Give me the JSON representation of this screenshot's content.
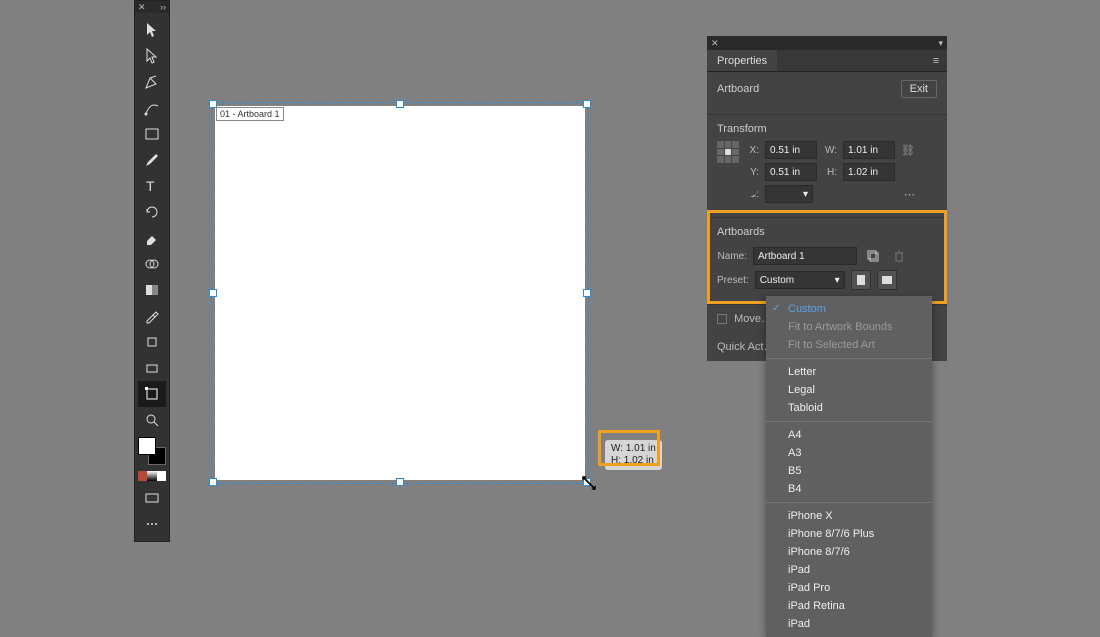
{
  "toolbar": {
    "close_glyph": "✕",
    "expand_glyph": "››"
  },
  "artboard": {
    "label": "01 - Artboard 1",
    "tooltip_w": "W: 1.01 in",
    "tooltip_h": "H: 1.02 in"
  },
  "panel": {
    "close_glyph": "✕",
    "flyout_glyph": "≡",
    "tab": "Properties",
    "selection_type": "Artboard",
    "exit_label": "Exit",
    "transform": {
      "title": "Transform",
      "x_label": "X:",
      "y_label": "Y:",
      "w_label": "W:",
      "h_label": "H:",
      "x": "0.51 in",
      "y": "0.51 in",
      "w": "1.01 in",
      "h": "1.02 in",
      "angle_label": "⦟:"
    },
    "artboards": {
      "title": "Artboards",
      "name_label": "Name:",
      "name_value": "Artboard 1",
      "preset_label": "Preset:",
      "preset_value": "Custom",
      "move_label": "Move…"
    },
    "quick_actions_title": "Quick Act…",
    "preset_options": {
      "selected": "Custom",
      "disabled": [
        "Fit to Artwork Bounds",
        "Fit to Selected Art"
      ],
      "groups": [
        [
          "Letter",
          "Legal",
          "Tabloid"
        ],
        [
          "A4",
          "A3",
          "B5",
          "B4"
        ],
        [
          "iPhone X",
          "iPhone 8/7/6 Plus",
          "iPhone 8/7/6",
          "iPad",
          "iPad Pro",
          "iPad Retina",
          "iPad"
        ]
      ]
    }
  }
}
